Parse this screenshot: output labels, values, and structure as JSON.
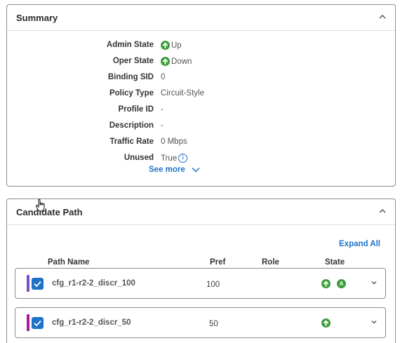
{
  "summary": {
    "title": "Summary",
    "rows": [
      {
        "key": "Admin State",
        "value": "Up",
        "icon": "arrow-up-green-icon"
      },
      {
        "key": "Oper State",
        "value": "Down",
        "icon": "arrow-up-green-icon"
      },
      {
        "key": "Binding SID",
        "value": "0"
      },
      {
        "key": "Policy Type",
        "value": "Circuit-Style"
      },
      {
        "key": "Profile ID",
        "value": "-"
      },
      {
        "key": "Description",
        "value": "-"
      },
      {
        "key": "Traffic Rate",
        "value": "0 Mbps"
      },
      {
        "key": "Unused",
        "value": "True",
        "icon": "info-icon"
      }
    ],
    "see_more": "See more"
  },
  "candidate": {
    "title": "Candidate Path",
    "expand_all": "Expand All",
    "columns": {
      "path_name": "Path Name",
      "pref": "Pref",
      "role": "Role",
      "state": "State"
    },
    "paths": [
      {
        "name": "cfg_r1-r2-2_discr_100",
        "pref": "100",
        "color": "#7b4fc9",
        "states": [
          "arrow-up-green-icon",
          "A"
        ]
      },
      {
        "name": "cfg_r1-r2-2_discr_50",
        "pref": "50",
        "color": "#b0189e",
        "states": [
          "arrow-up-green-icon"
        ]
      }
    ]
  },
  "colors": {
    "accent": "#1e73c8",
    "status_green": "#3d9c3a",
    "border": "#8c8c8c"
  }
}
